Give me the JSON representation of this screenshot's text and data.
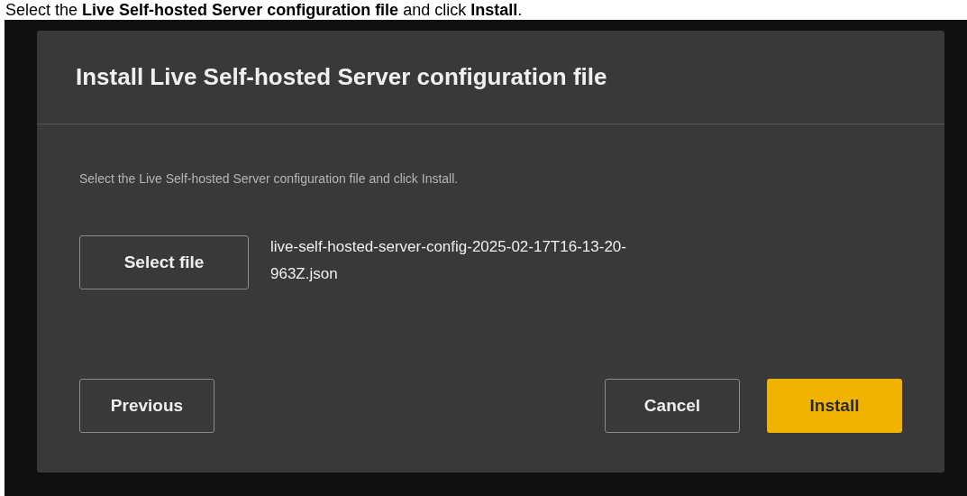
{
  "caption": "Select the **Live Self-hosted Server configuration file** and click **Install**.",
  "dialog": {
    "title": "Install Live Self-hosted Server configuration file",
    "instruction": "Select the Live Self-hosted Server configuration file and click Install.",
    "select_button": "Select file",
    "selected_file": "live-self-hosted-server-config-2025-02-17T16-13-20-963Z.json",
    "left_buttons": [
      {
        "label": "Previous",
        "kind": "secondary"
      }
    ],
    "right_buttons": [
      {
        "label": "Cancel",
        "kind": "secondary"
      },
      {
        "label": "Install",
        "kind": "primary"
      }
    ]
  }
}
